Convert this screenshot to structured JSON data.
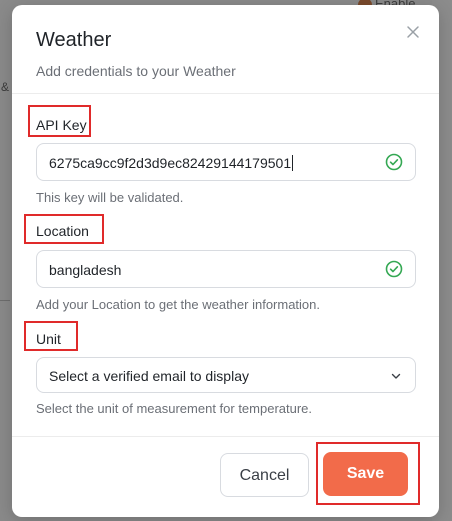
{
  "background": {
    "top_right_text": "Enable"
  },
  "dialog": {
    "title": "Weather",
    "subtitle": "Add credentials to your Weather"
  },
  "fields": {
    "api_key": {
      "label": "API Key",
      "value": "6275ca9cc9f2d3d9ec82429144179501",
      "help": "This key will be validated."
    },
    "location": {
      "label": "Location",
      "value": "bangladesh",
      "help": "Add your Location to get the weather information."
    },
    "unit": {
      "label": "Unit",
      "placeholder": "Select a verified email to display",
      "help": "Select the unit of measurement for temperature."
    }
  },
  "footer": {
    "cancel_label": "Cancel",
    "save_label": "Save"
  },
  "colors": {
    "accent": "#f26b4a",
    "success": "#34a853",
    "highlight": "#e02a2a"
  },
  "icons": {
    "close": "close-icon",
    "valid": "check-circle-icon",
    "dropdown": "chevron-down-icon"
  }
}
